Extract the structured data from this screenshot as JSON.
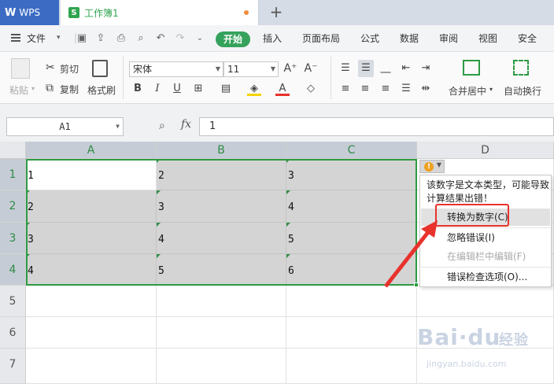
{
  "titlebar": {
    "app_tab": "WPS",
    "doc_tab": "工作簿1",
    "doc_icon": "S",
    "new_tab": "+"
  },
  "menubar": {
    "file": "文件",
    "start": "开始",
    "items": [
      "插入",
      "页面布局",
      "公式",
      "数据",
      "审阅",
      "视图",
      "安全"
    ]
  },
  "ribbon": {
    "paste": "粘贴",
    "cut": "剪切",
    "copy": "复制",
    "format_painter": "格式刷",
    "font_name": "宋体",
    "font_size": "11",
    "bold": "B",
    "italic": "I",
    "underline": "U",
    "font_color": "A",
    "increase_font": "A⁺",
    "decrease_font": "A⁻",
    "merge_center": "合并居中",
    "wrap_text": "自动换行"
  },
  "formula_bar": {
    "cell_ref": "A1",
    "fx": "fx",
    "value": "1"
  },
  "grid": {
    "columns": [
      "A",
      "B",
      "C",
      "D"
    ],
    "rows": [
      "1",
      "2",
      "3",
      "4",
      "5",
      "6",
      "7"
    ],
    "cells": [
      [
        "1",
        "2",
        "3"
      ],
      [
        "2",
        "3",
        "4"
      ],
      [
        "3",
        "4",
        "5"
      ],
      [
        "4",
        "5",
        "6"
      ]
    ]
  },
  "error_popup": {
    "warn_glyph": "!",
    "message": "该数字是文本类型，可能导致计算结果出错！",
    "items": [
      "转换为数字(C)",
      "忽略错误(I)",
      "在编辑栏中编辑(F)",
      "错误检查选项(O)..."
    ]
  },
  "watermark": {
    "brand": "Bai·du",
    "sub": "经验",
    "url": "jingyan.baidu.com"
  },
  "colors": {
    "accent_green": "#2e9b43",
    "wps_blue": "#3c6bc4",
    "highlight_red": "#e8322c"
  }
}
